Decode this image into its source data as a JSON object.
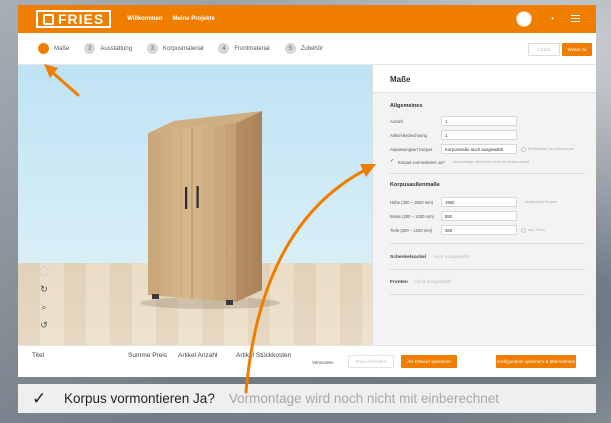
{
  "header": {
    "logo_text": "FRIES",
    "nav": [
      "Willkommen",
      "Meine Projekte"
    ],
    "menu_dot": "•"
  },
  "steps": [
    {
      "num": "1",
      "label": "Maße",
      "active": true
    },
    {
      "num": "2",
      "label": "Ausstattung",
      "active": false
    },
    {
      "num": "3",
      "label": "Korpusmaterial",
      "active": false
    },
    {
      "num": "4",
      "label": "Frontmaterial",
      "active": false
    },
    {
      "num": "5",
      "label": "Zubehör",
      "active": false
    }
  ],
  "step_buttons": {
    "back": "zurück",
    "next": "Weiter zu"
  },
  "viewport": {
    "tools": [
      "↻",
      "⌕",
      "↺"
    ],
    "tool_icons": [
      "rotate-icon",
      "zoom-icon",
      "reset-view-icon"
    ]
  },
  "panel": {
    "title": "Maße",
    "general": {
      "title": "Allgemeines",
      "rows": [
        {
          "label": "Anzahl",
          "value": "1"
        },
        {
          "label": "Artikel Bezeichnung",
          "value": "1"
        },
        {
          "label": "Anpassungsart Korpus",
          "value": "Korpusmaße auch ausgewählt"
        }
      ],
      "anpassung_hint": "Erforderlich neu berechnen",
      "korpus_check_label": "Korpus vormontieren Ja?",
      "korpus_check_hint": "Vormontage wird noch nicht mit einberechnet"
    },
    "dimensions": {
      "title": "Korpusaußenmaße",
      "rows": [
        {
          "label": "Höhe (300 – 2820 mm)",
          "value": "1900"
        },
        {
          "label": "Breite (300 – 1200 mm)",
          "value": "950"
        },
        {
          "label": "Tiefe (200 – 1200 mm)",
          "value": "360"
        }
      ],
      "height_hint": "Außenmaß Korpus",
      "depth_hint": "inkl. Front"
    },
    "toggles": [
      {
        "label": "Schenkelsockel",
        "state": "nicht ausgewählt"
      },
      {
        "label": "Fronten",
        "state": "nicht ausgewählt"
      }
    ]
  },
  "summary": {
    "columns": [
      "Titel",
      "Summe Preis",
      "Artikel Anzahl",
      "Artikel Stückkosten"
    ],
    "small": "Versenden",
    "buttons": [
      "Preis anfordern",
      "Als Entwurf speichern",
      "Konfiguration speichern & übernehmen"
    ]
  },
  "caption": {
    "check": "✓",
    "label": "Korpus vormontieren Ja?",
    "hint": "Vormontage wird noch nicht mit einberechnet"
  },
  "colors": {
    "brand": "#ef7d00",
    "sky": "#bfe3f4",
    "panel": "#f3f3f3"
  }
}
